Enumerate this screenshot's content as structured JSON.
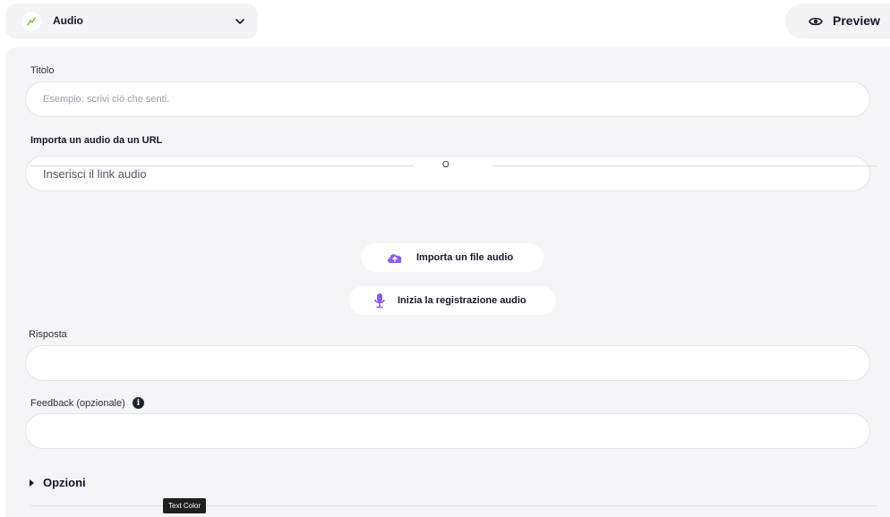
{
  "header": {
    "type_select_label": "Audio",
    "preview_label": "Preview"
  },
  "form": {
    "title_label": "Titolo",
    "title_placeholder": "Esempio: scrivi ciò che senti.",
    "url_label": "Importa un audio da un URL",
    "url_placeholder": "Inserisci il link audio",
    "divider_text": "O",
    "import_file_label": "Importa un file audio",
    "record_label": "Inizia la registrazione audio",
    "answer_label": "Risposta",
    "answer_value": "",
    "feedback_label": "Feedback (opzionale)",
    "feedback_value": "",
    "options_label": "Opzioni"
  },
  "tooltip": {
    "text": "Text Color"
  },
  "colors": {
    "accent_purple": "#8b5cf6",
    "icon_green": "#7ec850",
    "panel_bg": "#f5f5f8",
    "text_dark": "#15152e"
  },
  "icons": {
    "type_icon": "audio-wave-icon",
    "chevron": "chevron-down-icon",
    "preview": "eye-icon",
    "import_file": "cloud-upload-icon",
    "record": "microphone-icon",
    "feedback_info": "info-icon",
    "options_toggle": "caret-right-icon"
  }
}
